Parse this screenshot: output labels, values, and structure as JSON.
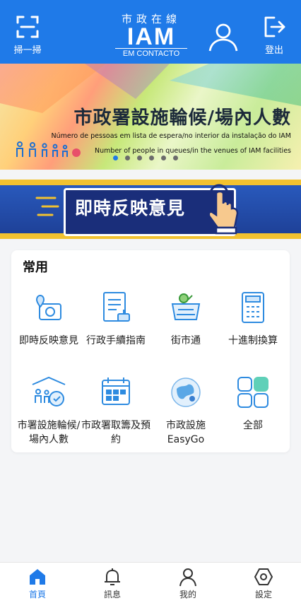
{
  "header": {
    "scan_label": "掃一掃",
    "logout_label": "登出",
    "logo": {
      "cn": "市政在線",
      "big": "IAM",
      "sub": "EM CONTACTO"
    }
  },
  "banner": {
    "title": "市政署設施輪候/場內人數",
    "subtitle_pt": "Número de pessoas em lista de espera/no interior da instalação do IAM",
    "subtitle_en": "Number of people in queues/in the venues of IAM facilities",
    "pages": 6,
    "active_page": 1
  },
  "feedback_banner": {
    "label": "即時反映意見"
  },
  "common": {
    "title": "常用",
    "items": [
      {
        "label": "即時反映意見",
        "icon": "camera-location-icon"
      },
      {
        "label": "行政手續指南",
        "icon": "document-stamp-icon"
      },
      {
        "label": "街市通",
        "icon": "market-basket-icon"
      },
      {
        "label": "十進制換算",
        "icon": "calculator-icon"
      },
      {
        "label": "市署設施輪候/場內人數",
        "icon": "queue-people-icon"
      },
      {
        "label": "市政署取籌及預約",
        "icon": "calendar-icon"
      },
      {
        "label": "市政設施EasyGo",
        "icon": "easygo-globe-icon"
      },
      {
        "label": "全部",
        "icon": "all-grid-icon"
      }
    ]
  },
  "tabbar": {
    "items": [
      {
        "label": "首頁",
        "icon": "home-icon",
        "active": true
      },
      {
        "label": "訊息",
        "icon": "bell-icon",
        "active": false
      },
      {
        "label": "我的",
        "icon": "person-icon",
        "active": false
      },
      {
        "label": "設定",
        "icon": "settings-icon",
        "active": false
      }
    ]
  },
  "colors": {
    "primary": "#1f7ae8",
    "accent": "#f2c230",
    "feedback_bg": "#1a2e7a"
  }
}
